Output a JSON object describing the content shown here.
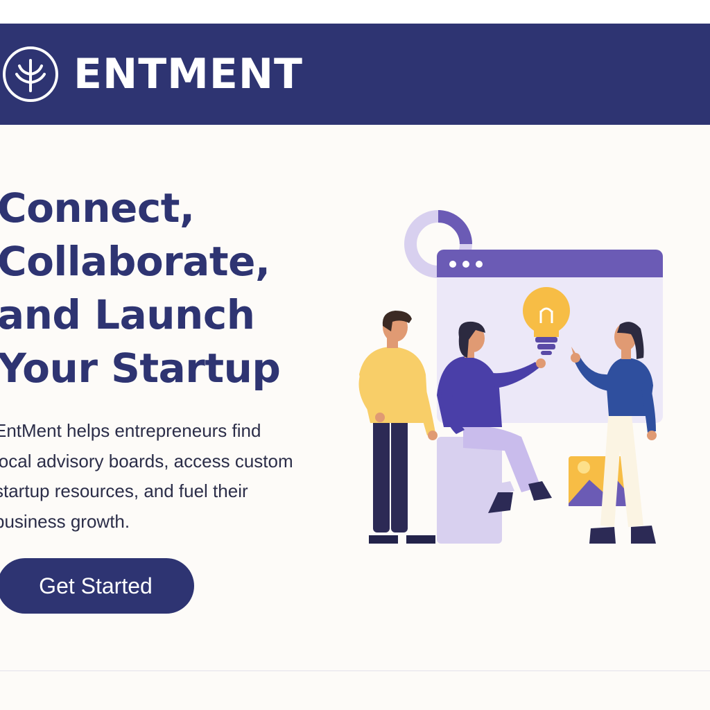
{
  "header": {
    "brand": "ENTMENT",
    "logo_icon": "sprout-leaf-icon",
    "background_color": "#2e3472"
  },
  "hero": {
    "title_lines": [
      "Connect,",
      "Collaborate,",
      "and Launch",
      "Your Startup"
    ],
    "description_lines": [
      "EntMent helps entrepreneurs find",
      "local advisory boards, access custom",
      "startup resources, and fuel their",
      "business growth."
    ],
    "cta_label": "Get Started"
  },
  "illustration": {
    "icons": [
      "donut-chart-icon",
      "browser-window-icon",
      "lightbulb-icon",
      "image-icon"
    ],
    "colors": {
      "primary": "#2e3472",
      "accent_purple": "#6b5bb5",
      "lavender": "#d8d0ef",
      "bulb_yellow": "#f7bd45"
    }
  }
}
